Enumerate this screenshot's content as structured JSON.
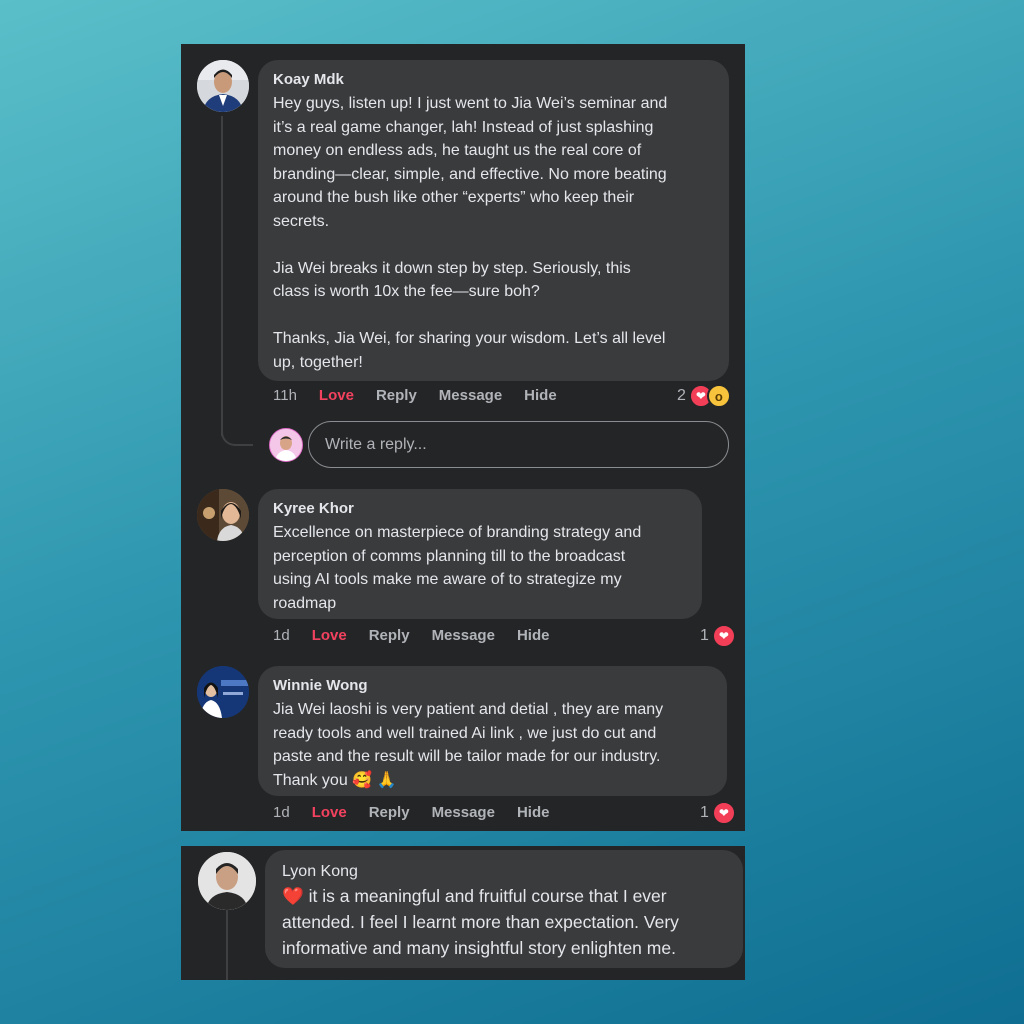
{
  "comments": [
    {
      "author": "Koay Mdk",
      "text": "Hey guys, listen up! I just went to Jia Wei’s seminar and\nit’s a real game changer, lah! Instead of just splashing\nmoney on endless ads, he taught us the real core of\nbranding—clear, simple, and effective. No more beating\naround the bush like other “experts” who keep their\nsecrets.\n\nJia Wei breaks it down step by step. Seriously, this\nclass is worth 10x the fee—sure boh?\n\nThanks, Jia Wei, for sharing your wisdom. Let’s all level\nup, together!",
      "time": "11h",
      "love": "Love",
      "reply": "Reply",
      "message": "Message",
      "hide": "Hide",
      "reaction_count": "2"
    },
    {
      "author": "Kyree Khor",
      "text": "Excellence on masterpiece of branding strategy and\nperception of comms planning till to the broadcast\nusing AI tools make me aware of to strategize my\nroadmap",
      "time": "1d",
      "love": "Love",
      "reply": "Reply",
      "message": "Message",
      "hide": "Hide",
      "reaction_count": "1"
    },
    {
      "author": "Winnie Wong",
      "text": "Jia Wei laoshi is very patient and detial , they are many\nready tools and well trained Ai link , we just do cut and\npaste and the result will be tailor made for our industry.\nThank you 🥰 🙏",
      "time": "1d",
      "love": "Love",
      "reply": "Reply",
      "message": "Message",
      "hide": "Hide",
      "reaction_count": "1"
    },
    {
      "author": "Lyon Kong",
      "text": "❤️ it is a meaningful and fruitful course that I ever\nattended. I feel I learnt more than expectation. Very\ninformative and many insightful story enlighten me."
    }
  ],
  "reply_box": {
    "placeholder": "Write a reply..."
  },
  "colors": {
    "panel_bg": "#242526",
    "bubble_bg": "#3a3b3c",
    "love": "#f3425f",
    "secondary_text": "#b0b3b8"
  }
}
